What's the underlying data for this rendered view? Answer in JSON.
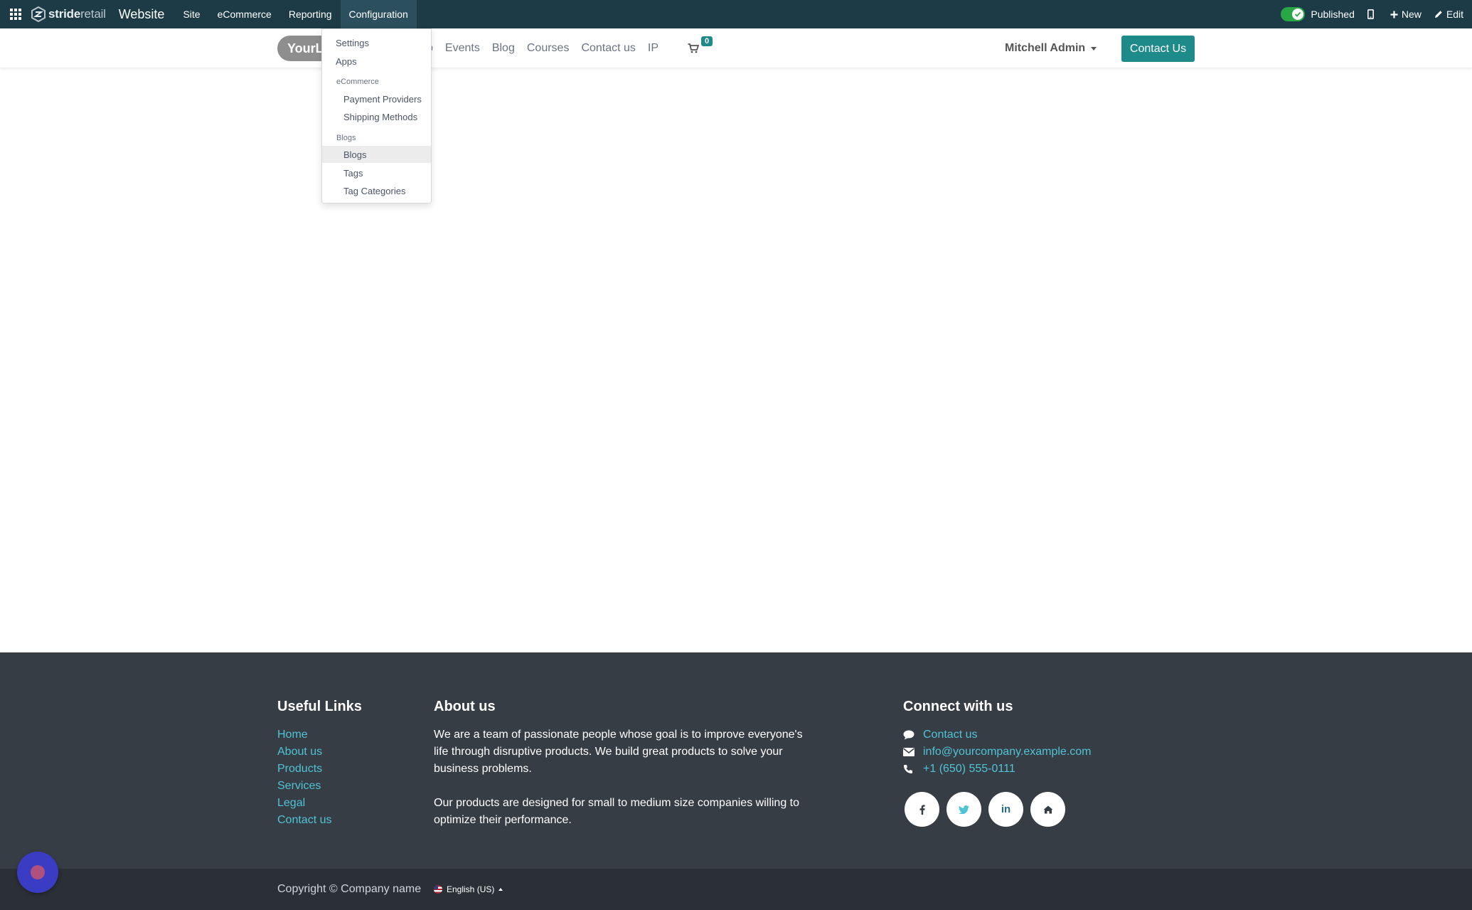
{
  "topbar": {
    "brand_bold": "stride",
    "brand_light": "retail",
    "app_name": "Website",
    "menu": [
      "Site",
      "eCommerce",
      "Reporting",
      "Configuration"
    ],
    "published_label": "Published",
    "new_label": "New",
    "edit_label": "Edit"
  },
  "site_header": {
    "logo_text": "YourLo",
    "nav_partial": "p",
    "nav": [
      "Events",
      "Blog",
      "Courses",
      "Contact us",
      "IP"
    ],
    "cart_count": "0",
    "user_name": "Mitchell Admin",
    "contact_button": "Contact Us"
  },
  "dropdown": {
    "settings": "Settings",
    "apps": "Apps",
    "ecommerce_header": "eCommerce",
    "payment_providers": "Payment Providers",
    "shipping_methods": "Shipping Methods",
    "blogs_header": "Blogs",
    "blogs": "Blogs",
    "tags": "Tags",
    "tag_categories": "Tag Categories"
  },
  "footer": {
    "useful_links_title": "Useful Links",
    "useful_links": [
      "Home",
      "About us",
      "Products",
      "Services",
      "Legal",
      "Contact us"
    ],
    "about_title": "About us",
    "about_p1": "We are a team of passionate people whose goal is to improve everyone's life through disruptive products. We build great products to solve your business problems.",
    "about_p2": "Our products are designed for small to medium size companies willing to optimize their performance.",
    "connect_title": "Connect with us",
    "contact_link": "Contact us",
    "email": "info@yourcompany.example.com",
    "phone": "+1 (650) 555-0111",
    "socials": [
      "facebook-icon",
      "twitter-icon",
      "linkedin-icon",
      "home-icon"
    ]
  },
  "bottom": {
    "copyright": "Copyright © Company name",
    "language": "English (US)"
  },
  "colors": {
    "topbar": "#1d3b47",
    "accent": "#1f8a8a",
    "footer": "#373d44",
    "link": "#4fc3d6"
  }
}
